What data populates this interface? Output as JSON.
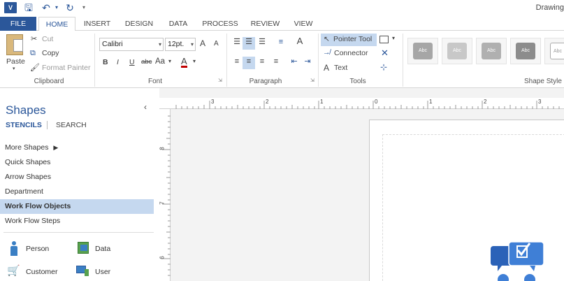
{
  "window": {
    "title": "Drawing"
  },
  "qat": {
    "logo": "V",
    "save_icon": "save-icon",
    "undo_icon": "undo-icon",
    "redo_icon": "redo-icon"
  },
  "tabs": [
    "FILE",
    "HOME",
    "INSERT",
    "DESIGN",
    "DATA",
    "PROCESS",
    "REVIEW",
    "VIEW"
  ],
  "clipboard": {
    "paste": "Paste",
    "cut": "Cut",
    "copy": "Copy",
    "format_painter": "Format Painter",
    "label": "Clipboard"
  },
  "font": {
    "family": "Calibri",
    "size": "12pt.",
    "bold": "B",
    "italic": "I",
    "underline": "U",
    "strike": "abc",
    "case": "Aa",
    "color_letter": "A",
    "label": "Font",
    "grow": "A",
    "shrink": "A"
  },
  "paragraph": {
    "label": "Paragraph"
  },
  "tools": {
    "pointer": "Pointer Tool",
    "connector": "Connector",
    "text": "Text",
    "label": "Tools"
  },
  "shape_styles": {
    "label": "Shape Style",
    "swatch_text": "Abc",
    "colors": [
      "#a6a6a6",
      "#c8c8c8",
      "#b0b0b0",
      "#8c8c8c",
      "#ffffff"
    ]
  },
  "shapes_pane": {
    "title": "Shapes",
    "stencils": "STENCILS",
    "search": "SEARCH",
    "more_shapes": "More Shapes",
    "items": [
      "Quick Shapes",
      "Arrow Shapes",
      "Department",
      "Work Flow Objects",
      "Work Flow Steps"
    ],
    "selected": "Work Flow Objects",
    "shapes": [
      {
        "label": "Person",
        "icon": "person-icon"
      },
      {
        "label": "Data",
        "icon": "data-icon"
      },
      {
        "label": "Customer",
        "icon": "customer-icon"
      },
      {
        "label": "User",
        "icon": "user-icon"
      }
    ]
  },
  "ruler": {
    "h_labels": [
      "3",
      "2",
      "1",
      "0",
      "1",
      "2",
      "3"
    ],
    "v_labels": [
      "8",
      "7",
      "6"
    ]
  },
  "colors": {
    "accent": "#2b579a",
    "selected_item": "#c5d8ef"
  }
}
